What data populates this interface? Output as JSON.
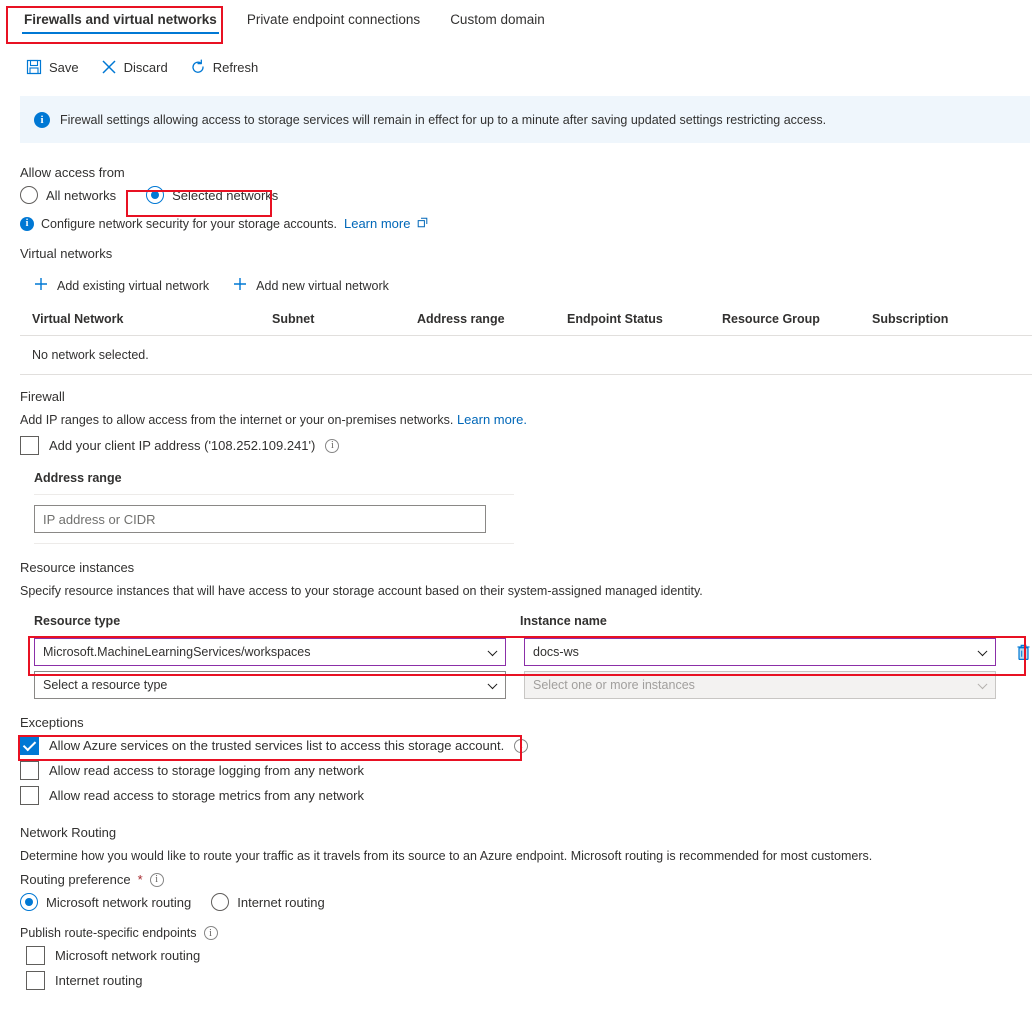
{
  "tabs": [
    {
      "label": "Firewalls and virtual networks",
      "active": true,
      "highlighted": true
    },
    {
      "label": "Private endpoint connections",
      "active": false,
      "highlighted": false
    },
    {
      "label": "Custom domain",
      "active": false,
      "highlighted": false
    }
  ],
  "toolbar": {
    "save_label": "Save",
    "discard_label": "Discard",
    "refresh_label": "Refresh",
    "save_icon": "save-floppy-icon",
    "discard_icon": "close-x-icon",
    "refresh_icon": "refresh-circular-arrow-icon"
  },
  "banner": {
    "icon": "info-icon",
    "text": "Firewall settings allowing access to storage services will remain in effect for up to a minute after saving updated settings restricting access.",
    "background": "#eff6fc"
  },
  "allow_access": {
    "label": "Allow access from",
    "options": [
      {
        "label": "All networks",
        "checked": false
      },
      {
        "label": "Selected networks",
        "checked": true
      }
    ],
    "note_text": "Configure network security for your storage accounts.",
    "note_link": "Learn more",
    "note_icon": "info-icon",
    "link_icon": "external-link-icon"
  },
  "virtual_networks": {
    "heading": "Virtual networks",
    "actions": [
      {
        "label": "Add existing virtual network",
        "icon": "plus-icon"
      },
      {
        "label": "Add new virtual network",
        "icon": "plus-icon"
      }
    ],
    "columns": [
      "Virtual Network",
      "Subnet",
      "Address range",
      "Endpoint Status",
      "Resource Group",
      "Subscription"
    ],
    "empty_text": "No network selected."
  },
  "firewall": {
    "heading": "Firewall",
    "description": "Add IP ranges to allow access from the internet or your on-premises networks.",
    "description_link": "Learn more.",
    "client_ip_checkbox": {
      "label": "Add your client IP address ('108.252.109.241')",
      "checked": false,
      "info_icon": "info-icon"
    },
    "address_range_label": "Address range",
    "address_range_placeholder": "IP address or CIDR",
    "address_range_value": ""
  },
  "resource_instances": {
    "heading": "Resource instances",
    "description": "Specify resource instances that will have access to your storage account based on their system-assigned managed identity.",
    "col_resource_type": "Resource type",
    "col_instance_name": "Instance name",
    "rows": [
      {
        "resource_type": "Microsoft.MachineLearningServices/workspaces",
        "instance_name": "docs-ws",
        "highlighted": true,
        "disabled": false,
        "delete_icon": "trash-icon"
      },
      {
        "resource_type": "Select a resource type",
        "instance_name": "Select one or more instances",
        "highlighted": false,
        "disabled": true,
        "delete_icon": ""
      }
    ]
  },
  "exceptions": {
    "heading": "Exceptions",
    "items": [
      {
        "label": "Allow Azure services on the trusted services list to access this storage account.",
        "checked": true,
        "has_info": true,
        "highlighted": true
      },
      {
        "label": "Allow read access to storage logging from any network",
        "checked": false,
        "has_info": false,
        "highlighted": false
      },
      {
        "label": "Allow read access to storage metrics from any network",
        "checked": false,
        "has_info": false,
        "highlighted": false
      }
    ]
  },
  "network_routing": {
    "heading": "Network Routing",
    "description": "Determine how you would like to route your traffic as it travels from its source to an Azure endpoint. Microsoft routing is recommended for most customers.",
    "routing_preference_label": "Routing preference",
    "required_marker": "*",
    "routing_preference_options": [
      {
        "label": "Microsoft network routing",
        "checked": true
      },
      {
        "label": "Internet routing",
        "checked": false
      }
    ],
    "publish_label": "Publish route-specific endpoints",
    "publish_options": [
      {
        "label": "Microsoft network routing",
        "checked": false
      },
      {
        "label": "Internet routing",
        "checked": false
      }
    ]
  },
  "colors": {
    "accent": "#0078d4",
    "link": "#0067b8",
    "highlight_box": "#e81123",
    "dropdown_highlight": "#8b2fa8",
    "banner_bg": "#eff6fc",
    "required_asterisk": "#a4262c"
  }
}
